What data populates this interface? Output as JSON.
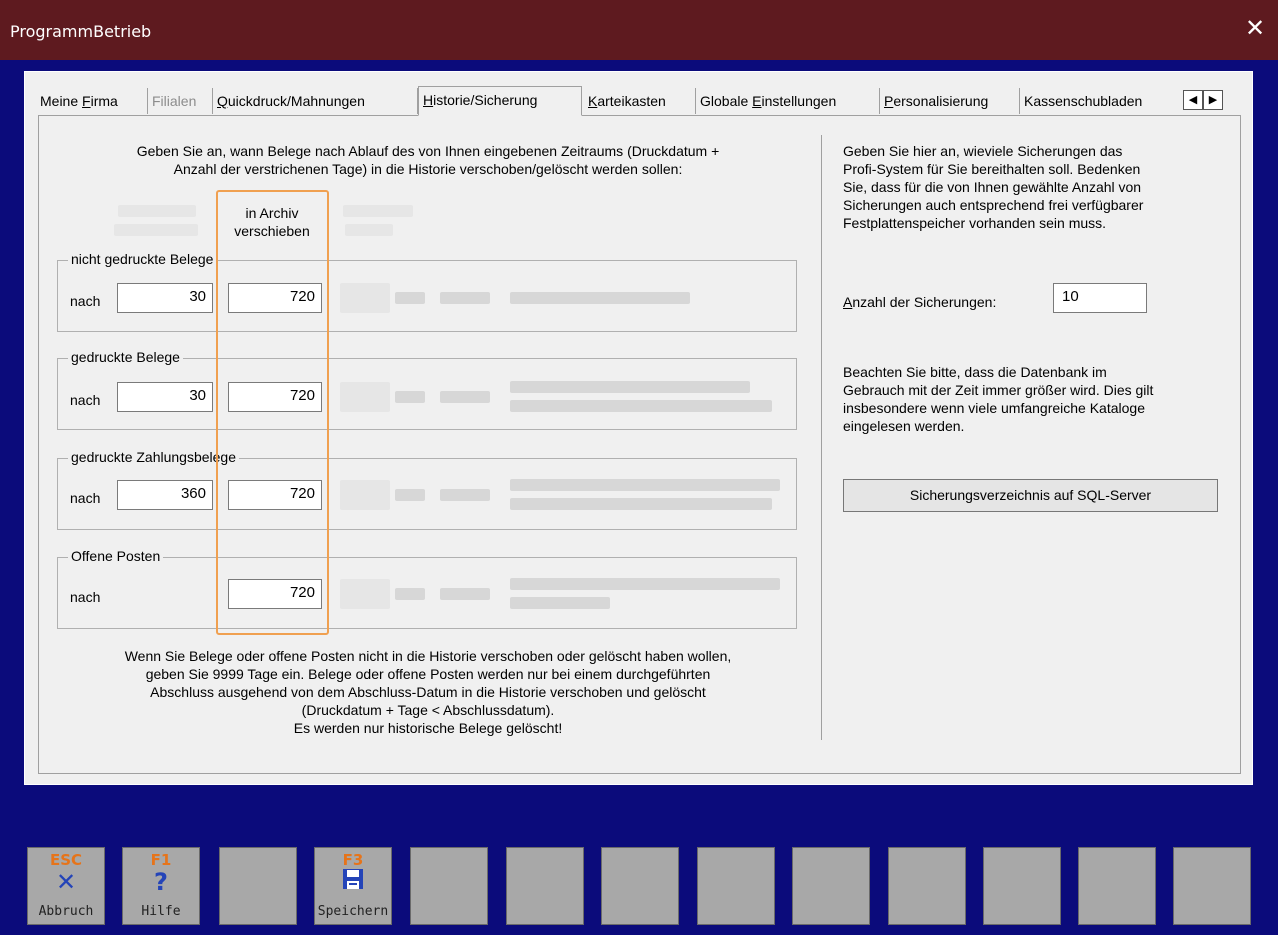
{
  "window": {
    "title": "ProgrammBetrieb",
    "close_glyph": "✕"
  },
  "tabs": [
    {
      "label": "Meine Firma",
      "ul": "F",
      "state": "normal"
    },
    {
      "label": "Filialen",
      "state": "disabled"
    },
    {
      "label": "Quickdruck/Mahnungen",
      "ul": "Q",
      "state": "normal"
    },
    {
      "label": "Historie/Sicherung",
      "ul": "H",
      "state": "active"
    },
    {
      "label": "Karteikasten",
      "ul": "K",
      "state": "normal"
    },
    {
      "label": "Globale Einstellungen",
      "ul": "E",
      "state": "normal"
    },
    {
      "label": "Personalisierung",
      "ul": "P",
      "state": "normal"
    },
    {
      "label": "Kassenschubladen",
      "state": "normal"
    }
  ],
  "tab_scroll": {
    "left": "◀",
    "right": "▶"
  },
  "left": {
    "intro_line1": "Geben Sie an, wann Belege nach Ablauf des von Ihnen eingebenen Zeitraums (Druckdatum +",
    "intro_line2": "Anzahl der verstrichenen Tage) in die Historie verschoben/gelöscht werden sollen:",
    "col_archive_line1": "in Archiv",
    "col_archive_line2": "verschieben",
    "groups": [
      {
        "legend": "nicht gedruckte Belege",
        "nach": "nach",
        "v1": "30",
        "v2": "720"
      },
      {
        "legend": "gedruckte Belege",
        "nach": "nach",
        "v1": "30",
        "v2": "720"
      },
      {
        "legend": "gedruckte Zahlungsbelege",
        "nach": "nach",
        "v1": "360",
        "v2": "720"
      },
      {
        "legend": "Offene Posten",
        "nach": "nach",
        "v1": "",
        "v2": "720"
      }
    ],
    "footer": [
      "Wenn Sie Belege oder offene Posten nicht in die Historie verschoben oder gelöscht haben wollen,",
      "geben Sie 9999 Tage ein. Belege oder offene Posten werden nur bei einem durchgeführten",
      "Abschluss ausgehend von dem Abschluss-Datum in die Historie verschoben und gelöscht",
      "(Druckdatum + Tage < Abschlussdatum).",
      "Es werden nur historische Belege gelöscht!"
    ]
  },
  "right": {
    "info_lines": [
      "Geben Sie hier an, wieviele Sicherungen das",
      "Profi-System für Sie bereithalten soll. Bedenken",
      "Sie, dass für die von Ihnen gewählte Anzahl von",
      "Sicherungen auch entsprechend frei verfügbarer",
      "Festplattenspeicher vorhanden sein muss."
    ],
    "backup_count_label": "Anzahl der Sicherungen:",
    "backup_count_value": "10",
    "note_lines": [
      "Beachten Sie bitte, dass die Datenbank im",
      "Gebrauch mit der Zeit immer größer wird. Dies gilt",
      "insbesondere wenn viele umfangreiche Kataloge",
      "eingelesen werden."
    ],
    "sql_button": "Sicherungsverzeichnis auf SQL-Server"
  },
  "fkeys": [
    {
      "key": "ESC",
      "icon": "close-icon",
      "glyph": "✕",
      "label": "Abbruch"
    },
    {
      "key": "F1",
      "icon": "help-icon",
      "glyph": "?",
      "label": "Hilfe"
    },
    {
      "key": "",
      "icon": "",
      "glyph": "",
      "label": ""
    },
    {
      "key": "F3",
      "icon": "save-icon",
      "glyph": "💾",
      "label": "Speichern"
    },
    {
      "key": "",
      "icon": "",
      "glyph": "",
      "label": ""
    },
    {
      "key": "",
      "icon": "",
      "glyph": "",
      "label": ""
    },
    {
      "key": "",
      "icon": "",
      "glyph": "",
      "label": ""
    },
    {
      "key": "",
      "icon": "",
      "glyph": "",
      "label": ""
    },
    {
      "key": "",
      "icon": "",
      "glyph": "",
      "label": ""
    },
    {
      "key": "",
      "icon": "",
      "glyph": "",
      "label": ""
    },
    {
      "key": "",
      "icon": "",
      "glyph": "",
      "label": ""
    },
    {
      "key": "",
      "icon": "",
      "glyph": "",
      "label": ""
    },
    {
      "key": "",
      "icon": "",
      "glyph": "",
      "label": ""
    }
  ],
  "colors": {
    "titlebar": "#5e1a1f",
    "background": "#0b0b7b",
    "fkey_label": "#e6741a",
    "highlight": "#f0a050"
  }
}
